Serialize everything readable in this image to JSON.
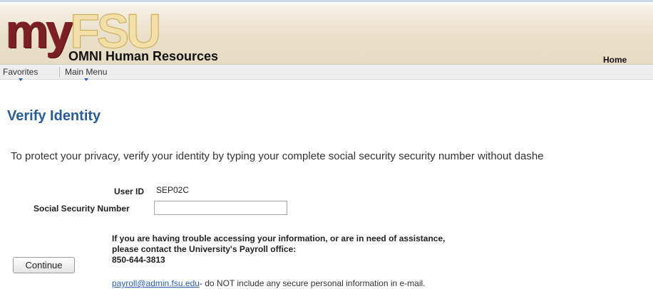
{
  "header": {
    "logo_prefix": "my",
    "logo_brand": "FSU",
    "app_title": "OMNI Human Resources",
    "home_link": "Home"
  },
  "menubar": {
    "items": [
      {
        "label": "Favorites"
      },
      {
        "label": "Main Menu"
      }
    ]
  },
  "page": {
    "title": "Verify Identity",
    "instructions": "To protect your privacy, verify your identity by typing your complete social security security number without dashe"
  },
  "form": {
    "user_id_label": "User ID",
    "user_id_value": "SEP02C",
    "ssn_label": "Social Security Number",
    "ssn_value": ""
  },
  "help": {
    "line1": "If you are having trouble accessing your information, or are in need of assistance,",
    "line2": "please contact the University's Payroll office:",
    "phone": "850-644-3813"
  },
  "actions": {
    "continue_label": "Continue"
  },
  "email": {
    "address": "payroll@admin.fsu.edu",
    "note": "- do NOT include any secure personal information in e-mail."
  }
}
